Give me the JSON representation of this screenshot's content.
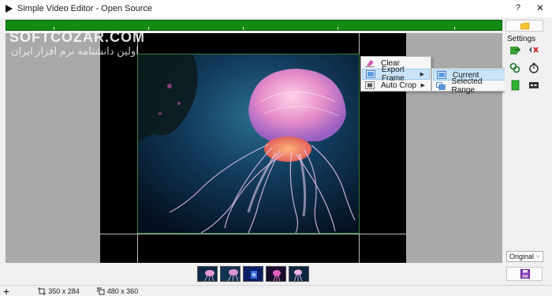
{
  "window": {
    "title": "Simple Video Editor - Open Source",
    "help_label": "?",
    "close_label": "✕"
  },
  "watermark": {
    "latin": "SOFTCOZAR.COM",
    "farsi": "اولین دانشنامه نرم افزار ایران"
  },
  "context_menu": {
    "items": [
      {
        "label": "Clear",
        "icon": "eraser-icon"
      },
      {
        "label": "Export Frame",
        "icon": "export-frame-icon",
        "has_submenu": true,
        "highlighted": true
      },
      {
        "label": "Auto Crop",
        "icon": "auto-crop-icon",
        "has_submenu": true
      }
    ],
    "submenu_arrow": "▶",
    "submenu": [
      {
        "label": "Current",
        "icon": "frame-icon",
        "highlighted": true
      },
      {
        "label": "Selected Range",
        "icon": "frames-icon"
      }
    ]
  },
  "sidebar": {
    "settings_label": "Settings",
    "quality_select": {
      "value": "Original",
      "arrow": "⌵"
    },
    "icons": [
      "folder-icon",
      "export-icon",
      "delete-icon",
      "link-icon",
      "timer-icon",
      "bookmark-icon",
      "subtitle-icon",
      "save-icon"
    ]
  },
  "thumbnails": {
    "count": 5
  },
  "status": {
    "add_label": "+",
    "crop_size": "350 x 284",
    "video_size": "480 x 360"
  },
  "colors": {
    "timeline": "#138a13",
    "menu_highlight": "#cce4f7",
    "preview_bg": "#a9a9a9"
  }
}
